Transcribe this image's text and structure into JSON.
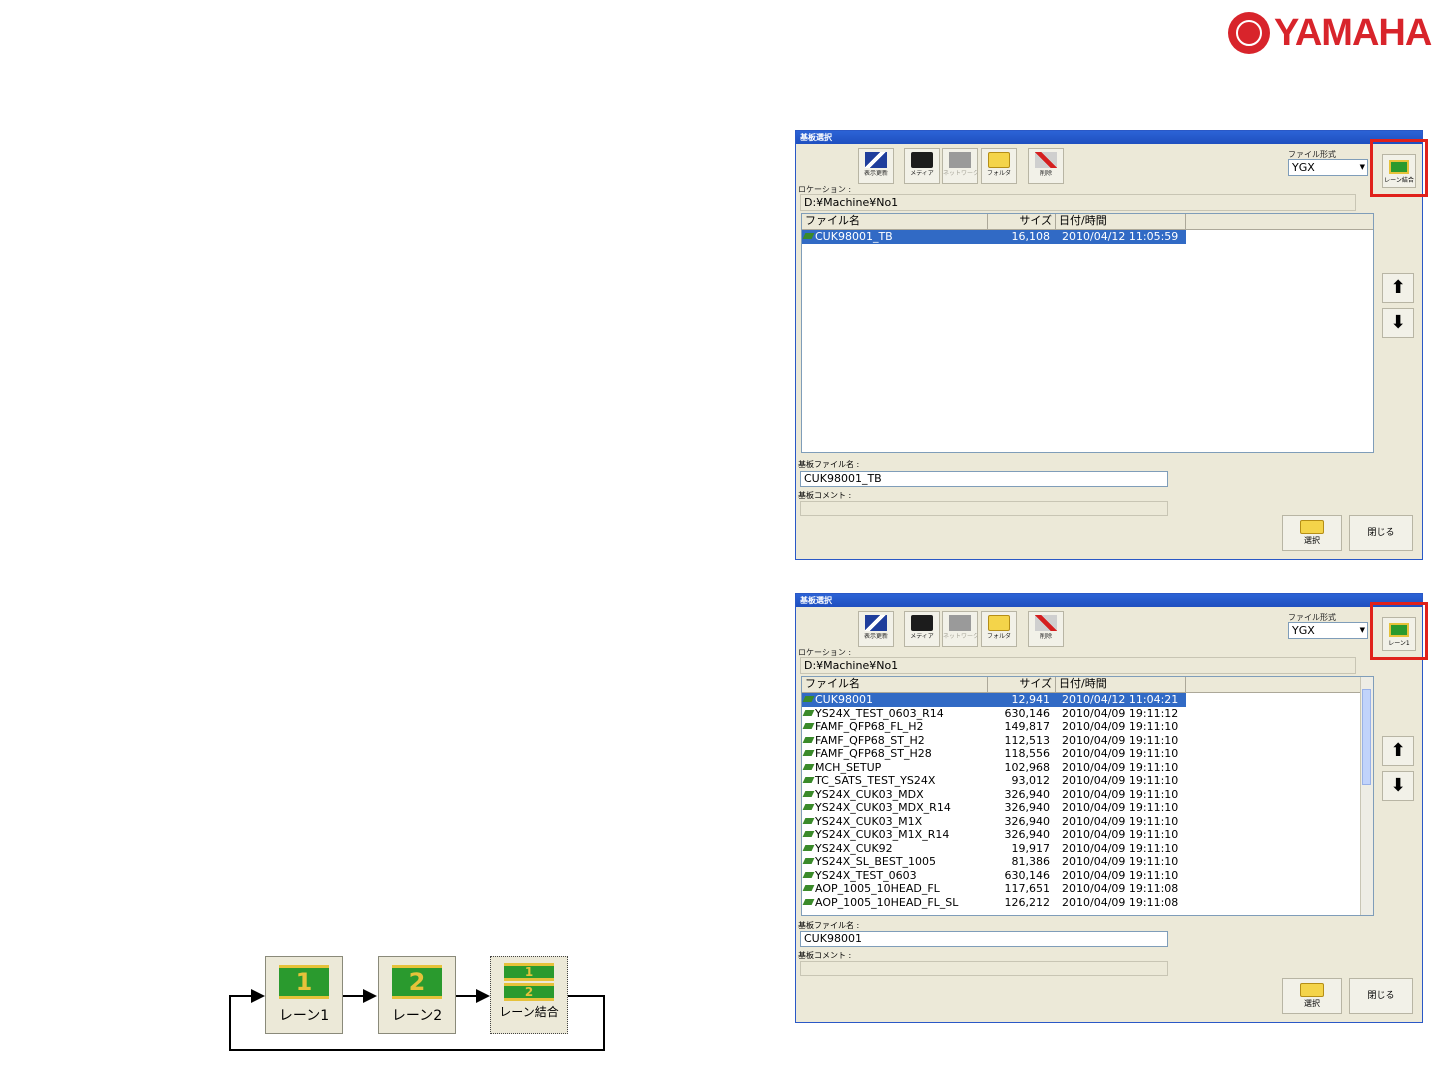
{
  "brand": {
    "name": "YAMAHA"
  },
  "dialog": {
    "title": "基板選択",
    "toolbar": [
      {
        "label": "表示更新",
        "icon": "refresh-view-icon",
        "enabled": true
      },
      {
        "label": "メディア",
        "icon": "floppy-disk-icon",
        "enabled": true
      },
      {
        "label": "ネットワーク",
        "icon": "network-icon",
        "enabled": false
      },
      {
        "label": "フォルダ",
        "icon": "folder-icon",
        "enabled": true
      },
      {
        "label": "削除",
        "icon": "delete-icon",
        "enabled": true
      }
    ],
    "file_format_label": "ファイル形式",
    "file_format_value": "YGX",
    "location_label": "ロケーション :",
    "location_value": "D:¥Machine¥No1",
    "columns": [
      "ファイル名",
      "サイズ",
      "日付/時間"
    ],
    "file_name_label": "基板ファイル名 :",
    "comment_label": "基板コメント :",
    "select_label": "選択",
    "close_label": "閉じる",
    "up_arrow": "⬆",
    "down_arrow": "⬇"
  },
  "dialog1": {
    "lane_button_label": "レーン結合",
    "rows": [
      {
        "name": "CUK98001_TB",
        "size": "16,108",
        "date": "2010/04/12 11:05:59",
        "selected": true
      }
    ],
    "file_name_value": "CUK98001_TB"
  },
  "dialog2": {
    "lane_button_label": "レーン1",
    "rows": [
      {
        "name": "CUK98001",
        "size": "12,941",
        "date": "2010/04/12 11:04:21",
        "selected": true
      },
      {
        "name": "YS24X_TEST_0603_R14",
        "size": "630,146",
        "date": "2010/04/09 19:11:12"
      },
      {
        "name": "FAMF_QFP68_FL_H2",
        "size": "149,817",
        "date": "2010/04/09 19:11:10"
      },
      {
        "name": "FAMF_QFP68_ST_H2",
        "size": "112,513",
        "date": "2010/04/09 19:11:10"
      },
      {
        "name": "FAMF_QFP68_ST_H28",
        "size": "118,556",
        "date": "2010/04/09 19:11:10"
      },
      {
        "name": "MCH_SETUP",
        "size": "102,968",
        "date": "2010/04/09 19:11:10"
      },
      {
        "name": "TC_SATS_TEST_YS24X",
        "size": "93,012",
        "date": "2010/04/09 19:11:10"
      },
      {
        "name": "YS24X_CUK03_MDX",
        "size": "326,940",
        "date": "2010/04/09 19:11:10"
      },
      {
        "name": "YS24X_CUK03_MDX_R14",
        "size": "326,940",
        "date": "2010/04/09 19:11:10"
      },
      {
        "name": "YS24X_CUK03_M1X",
        "size": "326,940",
        "date": "2010/04/09 19:11:10"
      },
      {
        "name": "YS24X_CUK03_M1X_R14",
        "size": "326,940",
        "date": "2010/04/09 19:11:10"
      },
      {
        "name": "YS24X_CUK92",
        "size": "19,917",
        "date": "2010/04/09 19:11:10"
      },
      {
        "name": "YS24X_SL_BEST_1005",
        "size": "81,386",
        "date": "2010/04/09 19:11:10"
      },
      {
        "name": "YS24X_TEST_0603",
        "size": "630,146",
        "date": "2010/04/09 19:11:10"
      },
      {
        "name": "AOP_1005_10HEAD_FL",
        "size": "117,651",
        "date": "2010/04/09 19:11:08"
      },
      {
        "name": "AOP_1005_10HEAD_FL_SL",
        "size": "126,212",
        "date": "2010/04/09 19:11:08"
      }
    ],
    "file_name_value": "CUK98001"
  },
  "lanes": [
    {
      "label": "レーン1",
      "badge": "1"
    },
    {
      "label": "レーン2",
      "badge": "2"
    },
    {
      "label": "レーン結合",
      "badge_top": "1",
      "badge_bottom": "2"
    }
  ]
}
